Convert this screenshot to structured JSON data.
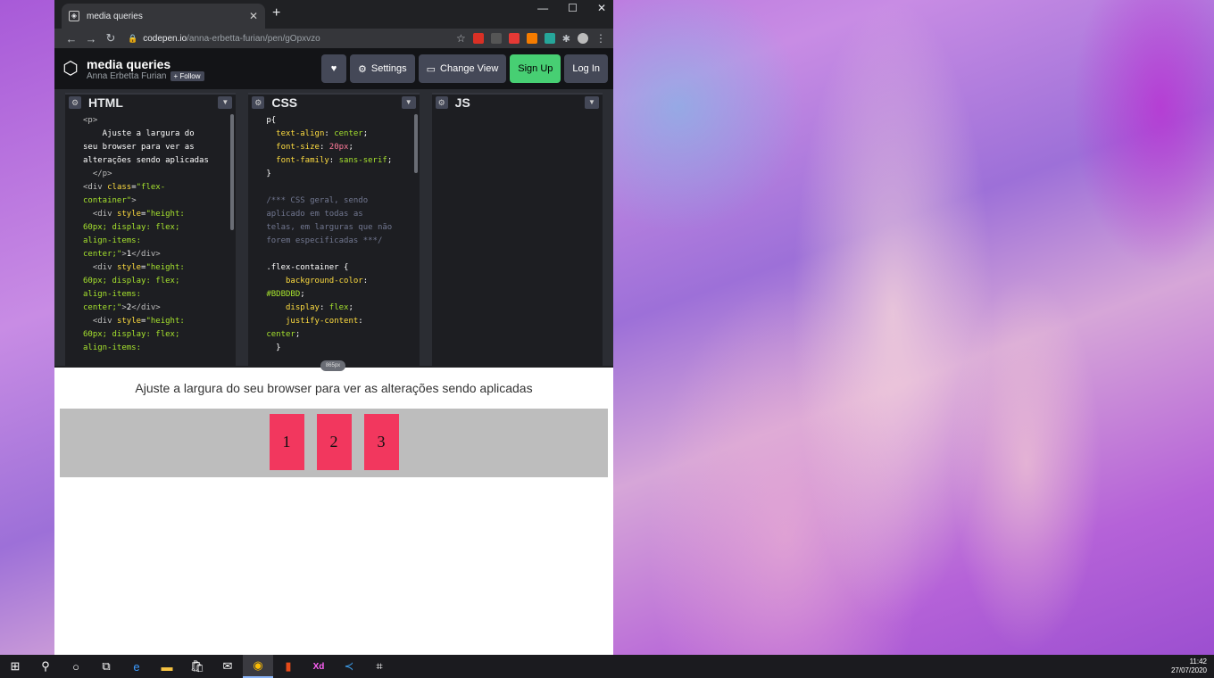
{
  "browser": {
    "tab_title": "media queries",
    "url_host": "codepen.io",
    "url_path": "/anna-erbetta-furian/pen/gOpxvzo"
  },
  "codepen": {
    "pen_title": "media queries",
    "author": "Anna Erbetta Furian",
    "follow_label": "+ Follow",
    "settings_label": "Settings",
    "change_view_label": "Change View",
    "signup_label": "Sign Up",
    "login_label": "Log In"
  },
  "editors": {
    "html_title": "HTML",
    "css_title": "CSS",
    "js_title": "JS"
  },
  "preview": {
    "paragraph": "Ajuste a largura do seu browser para ver as alterações sendo aplicadas",
    "boxes": [
      "1",
      "2",
      "3"
    ],
    "resize_label": "865px"
  },
  "taskbar": {
    "time": "11:42",
    "date": "27/07/2020"
  }
}
